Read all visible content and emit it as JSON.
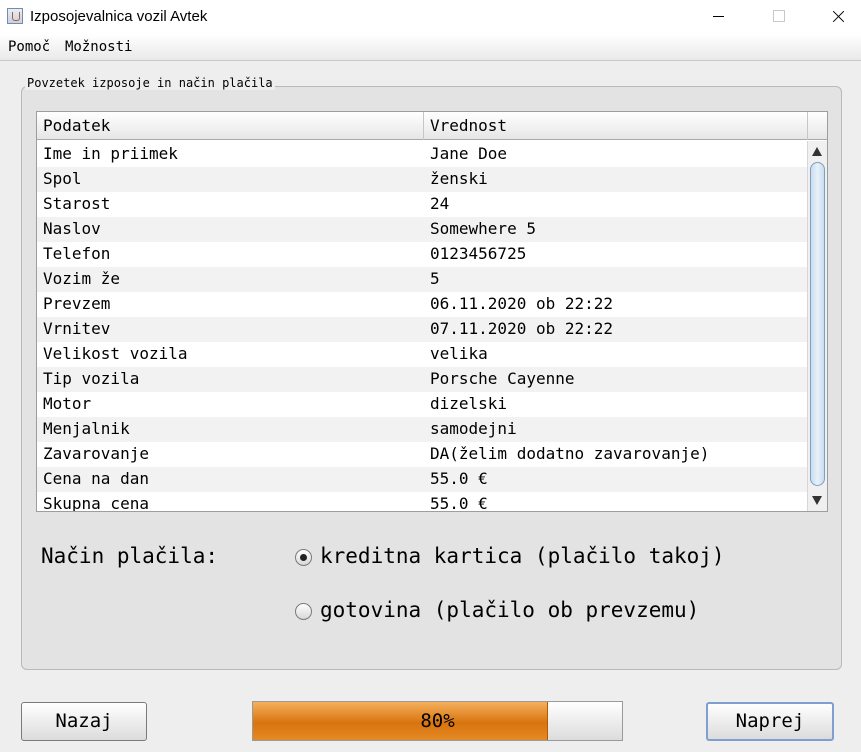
{
  "window": {
    "title": "Izposojevalnica vozil Avtek"
  },
  "menu": {
    "items": [
      "Pomoč",
      "Možnosti"
    ]
  },
  "panel": {
    "title": "Povzetek izposoje in način plačila"
  },
  "table": {
    "headers": [
      "Podatek",
      "Vrednost"
    ],
    "rows": [
      [
        "Ime in priimek",
        "Jane Doe"
      ],
      [
        "Spol",
        "ženski"
      ],
      [
        "Starost",
        "24"
      ],
      [
        "Naslov",
        "Somewhere 5"
      ],
      [
        "Telefon",
        "0123456725"
      ],
      [
        "Vozim že",
        "5"
      ],
      [
        "Prevzem",
        "06.11.2020 ob 22:22"
      ],
      [
        "Vrnitev",
        "07.11.2020 ob 22:22"
      ],
      [
        "Velikost vozila",
        "velika"
      ],
      [
        "Tip vozila",
        "Porsche Cayenne"
      ],
      [
        "Motor",
        "dizelski"
      ],
      [
        "Menjalnik",
        "samodejni"
      ],
      [
        "Zavarovanje",
        "DA(želim dodatno zavarovanje)"
      ],
      [
        "Cena na dan",
        "55.0 €"
      ],
      [
        "Skupna cena",
        "55.0 €"
      ]
    ]
  },
  "payment": {
    "label": "Način plačila:",
    "options": [
      {
        "label": "kreditna kartica (plačilo takoj)",
        "selected": true
      },
      {
        "label": "gotovina (plačilo ob prevzemu)",
        "selected": false
      }
    ]
  },
  "footer": {
    "back_label": "Nazaj",
    "next_label": "Naprej",
    "progress_value": 80,
    "progress_text": "80%"
  }
}
